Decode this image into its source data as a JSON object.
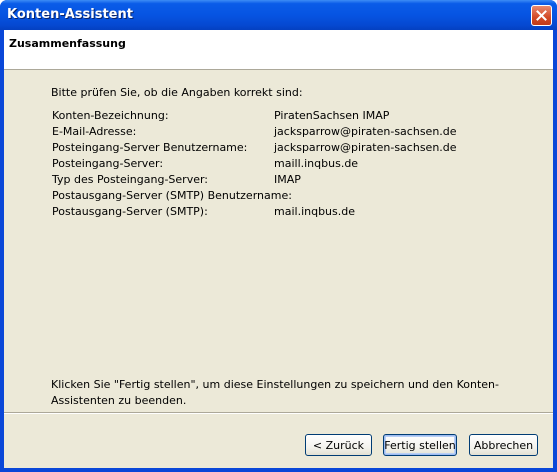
{
  "window": {
    "title": "Konten-Assistent"
  },
  "header": {
    "title": "Zusammenfassung"
  },
  "intro": "Bitte prüfen Sie, ob die Angaben korrekt sind:",
  "summary": [
    {
      "label": "Konten-Bezeichnung:",
      "value": "PiratenSachsen IMAP"
    },
    {
      "label": "E-Mail-Adresse:",
      "value": "jacksparrow@piraten-sachsen.de"
    },
    {
      "label": "Posteingang-Server Benutzername:",
      "value": "jacksparrow@piraten-sachsen.de"
    },
    {
      "label": "Posteingang-Server:",
      "value": "maill.inqbus.de"
    },
    {
      "label": "Typ des Posteingang-Server:",
      "value": "IMAP"
    },
    {
      "label": "Postausgang-Server (SMTP) Benutzername:",
      "value": ""
    },
    {
      "label": "Postausgang-Server (SMTP):",
      "value": "mail.inqbus.de"
    }
  ],
  "footer_text": "Klicken Sie \"Fertig stellen\", um diese Einstellungen zu speichern und den Konten-Assistenten zu beenden.",
  "buttons": {
    "back": "< Zurück",
    "finish": "Fertig stellen",
    "cancel": "Abbrechen"
  },
  "icons": {
    "close": "close-icon"
  },
  "colors": {
    "titlebar": "#0654e2",
    "client": "#ece9d8",
    "close_button": "#d24a26"
  }
}
